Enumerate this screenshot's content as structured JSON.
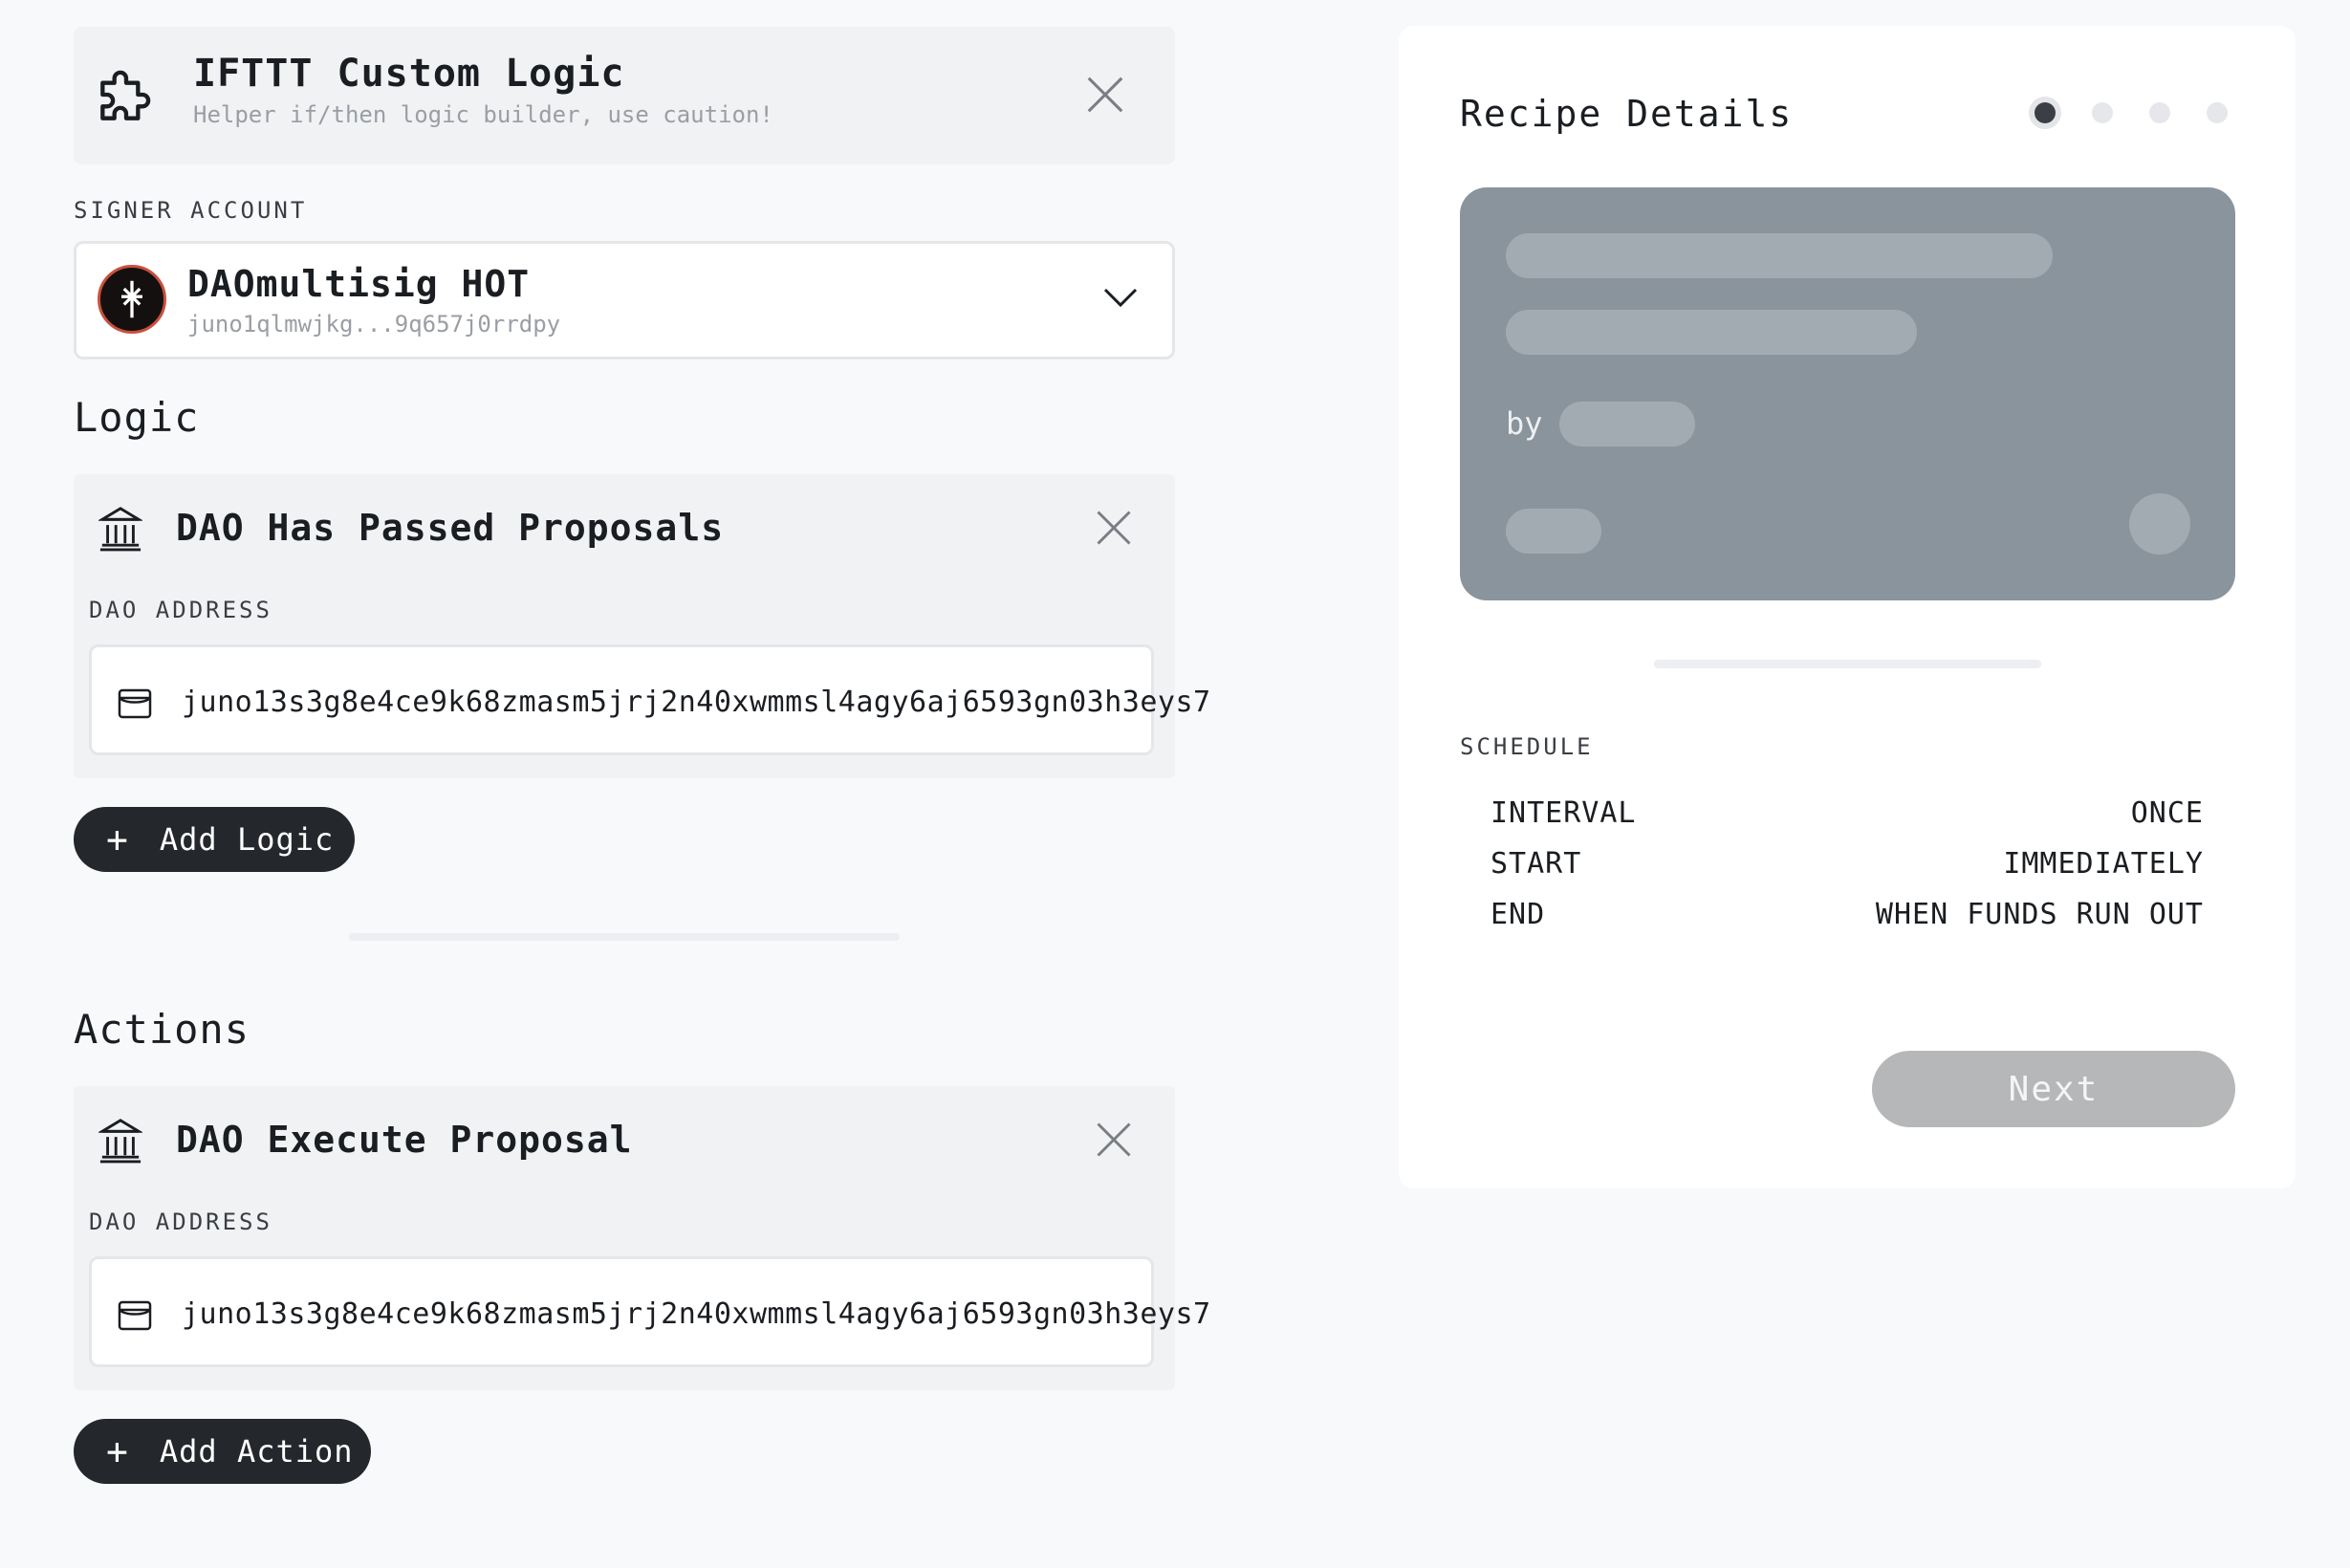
{
  "header": {
    "title": "IFTTT Custom Logic",
    "subtitle": "Helper if/then logic builder, use caution!"
  },
  "signer": {
    "label": "SIGNER ACCOUNT",
    "name": "DAOmultisig HOT",
    "address": "juno1qlmwjkg...9q657j0rrdpy"
  },
  "logic": {
    "heading": "Logic",
    "items": [
      {
        "title": "DAO Has Passed Proposals",
        "field_label": "DAO ADDRESS",
        "address": "juno13s3g8e4ce9k68zmasm5jrj2n40xwmmsl4agy6aj6593gn03h3eys7"
      }
    ],
    "add_label": "Add Logic"
  },
  "actions": {
    "heading": "Actions",
    "items": [
      {
        "title": "DAO Execute Proposal",
        "field_label": "DAO ADDRESS",
        "address": "juno13s3g8e4ce9k68zmasm5jrj2n40xwmmsl4agy6aj6593gn03h3eys7"
      }
    ],
    "add_label": "Add Action"
  },
  "recipe": {
    "title": "Recipe Details",
    "steps_total": 4,
    "step_active": 1,
    "by_label": "by",
    "schedule_label": "SCHEDULE",
    "schedule": [
      {
        "key": "INTERVAL",
        "value": "ONCE"
      },
      {
        "key": "START",
        "value": "IMMEDIATELY"
      },
      {
        "key": "END",
        "value": "WHEN FUNDS RUN OUT"
      }
    ],
    "next_label": "Next"
  },
  "colors": {
    "page_bg": "#f8f9fb",
    "card_bg": "#f1f2f4",
    "dark_button": "#24272b",
    "recipe_card": "#8a949d",
    "next_disabled": "#b6b7b8"
  }
}
